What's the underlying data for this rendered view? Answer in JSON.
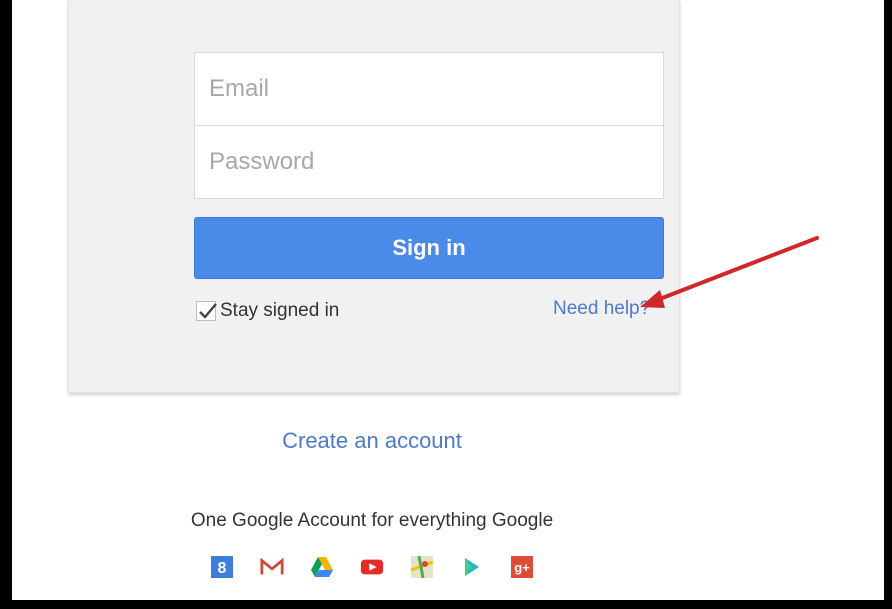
{
  "login": {
    "email_placeholder": "Email",
    "password_placeholder": "Password",
    "signin_label": "Sign in",
    "stay_signed_in_label": "Stay signed in",
    "stay_signed_in_checked": true,
    "need_help_label": "Need help?"
  },
  "footer": {
    "create_account_label": "Create an account",
    "tagline": "One Google Account for everything Google"
  },
  "products": [
    {
      "icon": "google-search-icon"
    },
    {
      "icon": "gmail-icon"
    },
    {
      "icon": "google-drive-icon"
    },
    {
      "icon": "youtube-icon"
    },
    {
      "icon": "google-maps-icon"
    },
    {
      "icon": "google-play-icon"
    },
    {
      "icon": "google-plus-icon"
    }
  ],
  "colors": {
    "signin_button": "#4a8ae8",
    "link": "#4c7bc9",
    "annotation_arrow": "#d0282a"
  }
}
